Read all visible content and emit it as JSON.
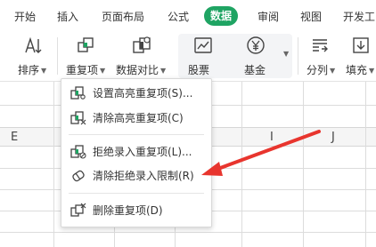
{
  "tabs": [
    {
      "label": "开始",
      "active": false
    },
    {
      "label": "插入",
      "active": false
    },
    {
      "label": "页面布局",
      "active": false
    },
    {
      "label": "公式",
      "active": false
    },
    {
      "label": "数据",
      "active": true
    },
    {
      "label": "审阅",
      "active": false
    },
    {
      "label": "视图",
      "active": false
    },
    {
      "label": "开发工",
      "active": false
    }
  ],
  "ribbon": {
    "sort": "排序",
    "duplicates": "重复项",
    "compare": "数据对比",
    "stock": "股票",
    "fund": "基金",
    "split": "分列",
    "fill": "填充"
  },
  "columns": [
    "E",
    "I",
    "J"
  ],
  "menu": {
    "items": [
      "设置高亮重复项(S)...",
      "清除高亮重复项(C)",
      "拒绝录入重复项(L)...",
      "清除拒绝录入限制(R)",
      "删除重复项(D)"
    ]
  },
  "colors": {
    "accent": "#1fa463",
    "annotation_arrow": "#e8352e",
    "icon_green": "#1fa463"
  }
}
